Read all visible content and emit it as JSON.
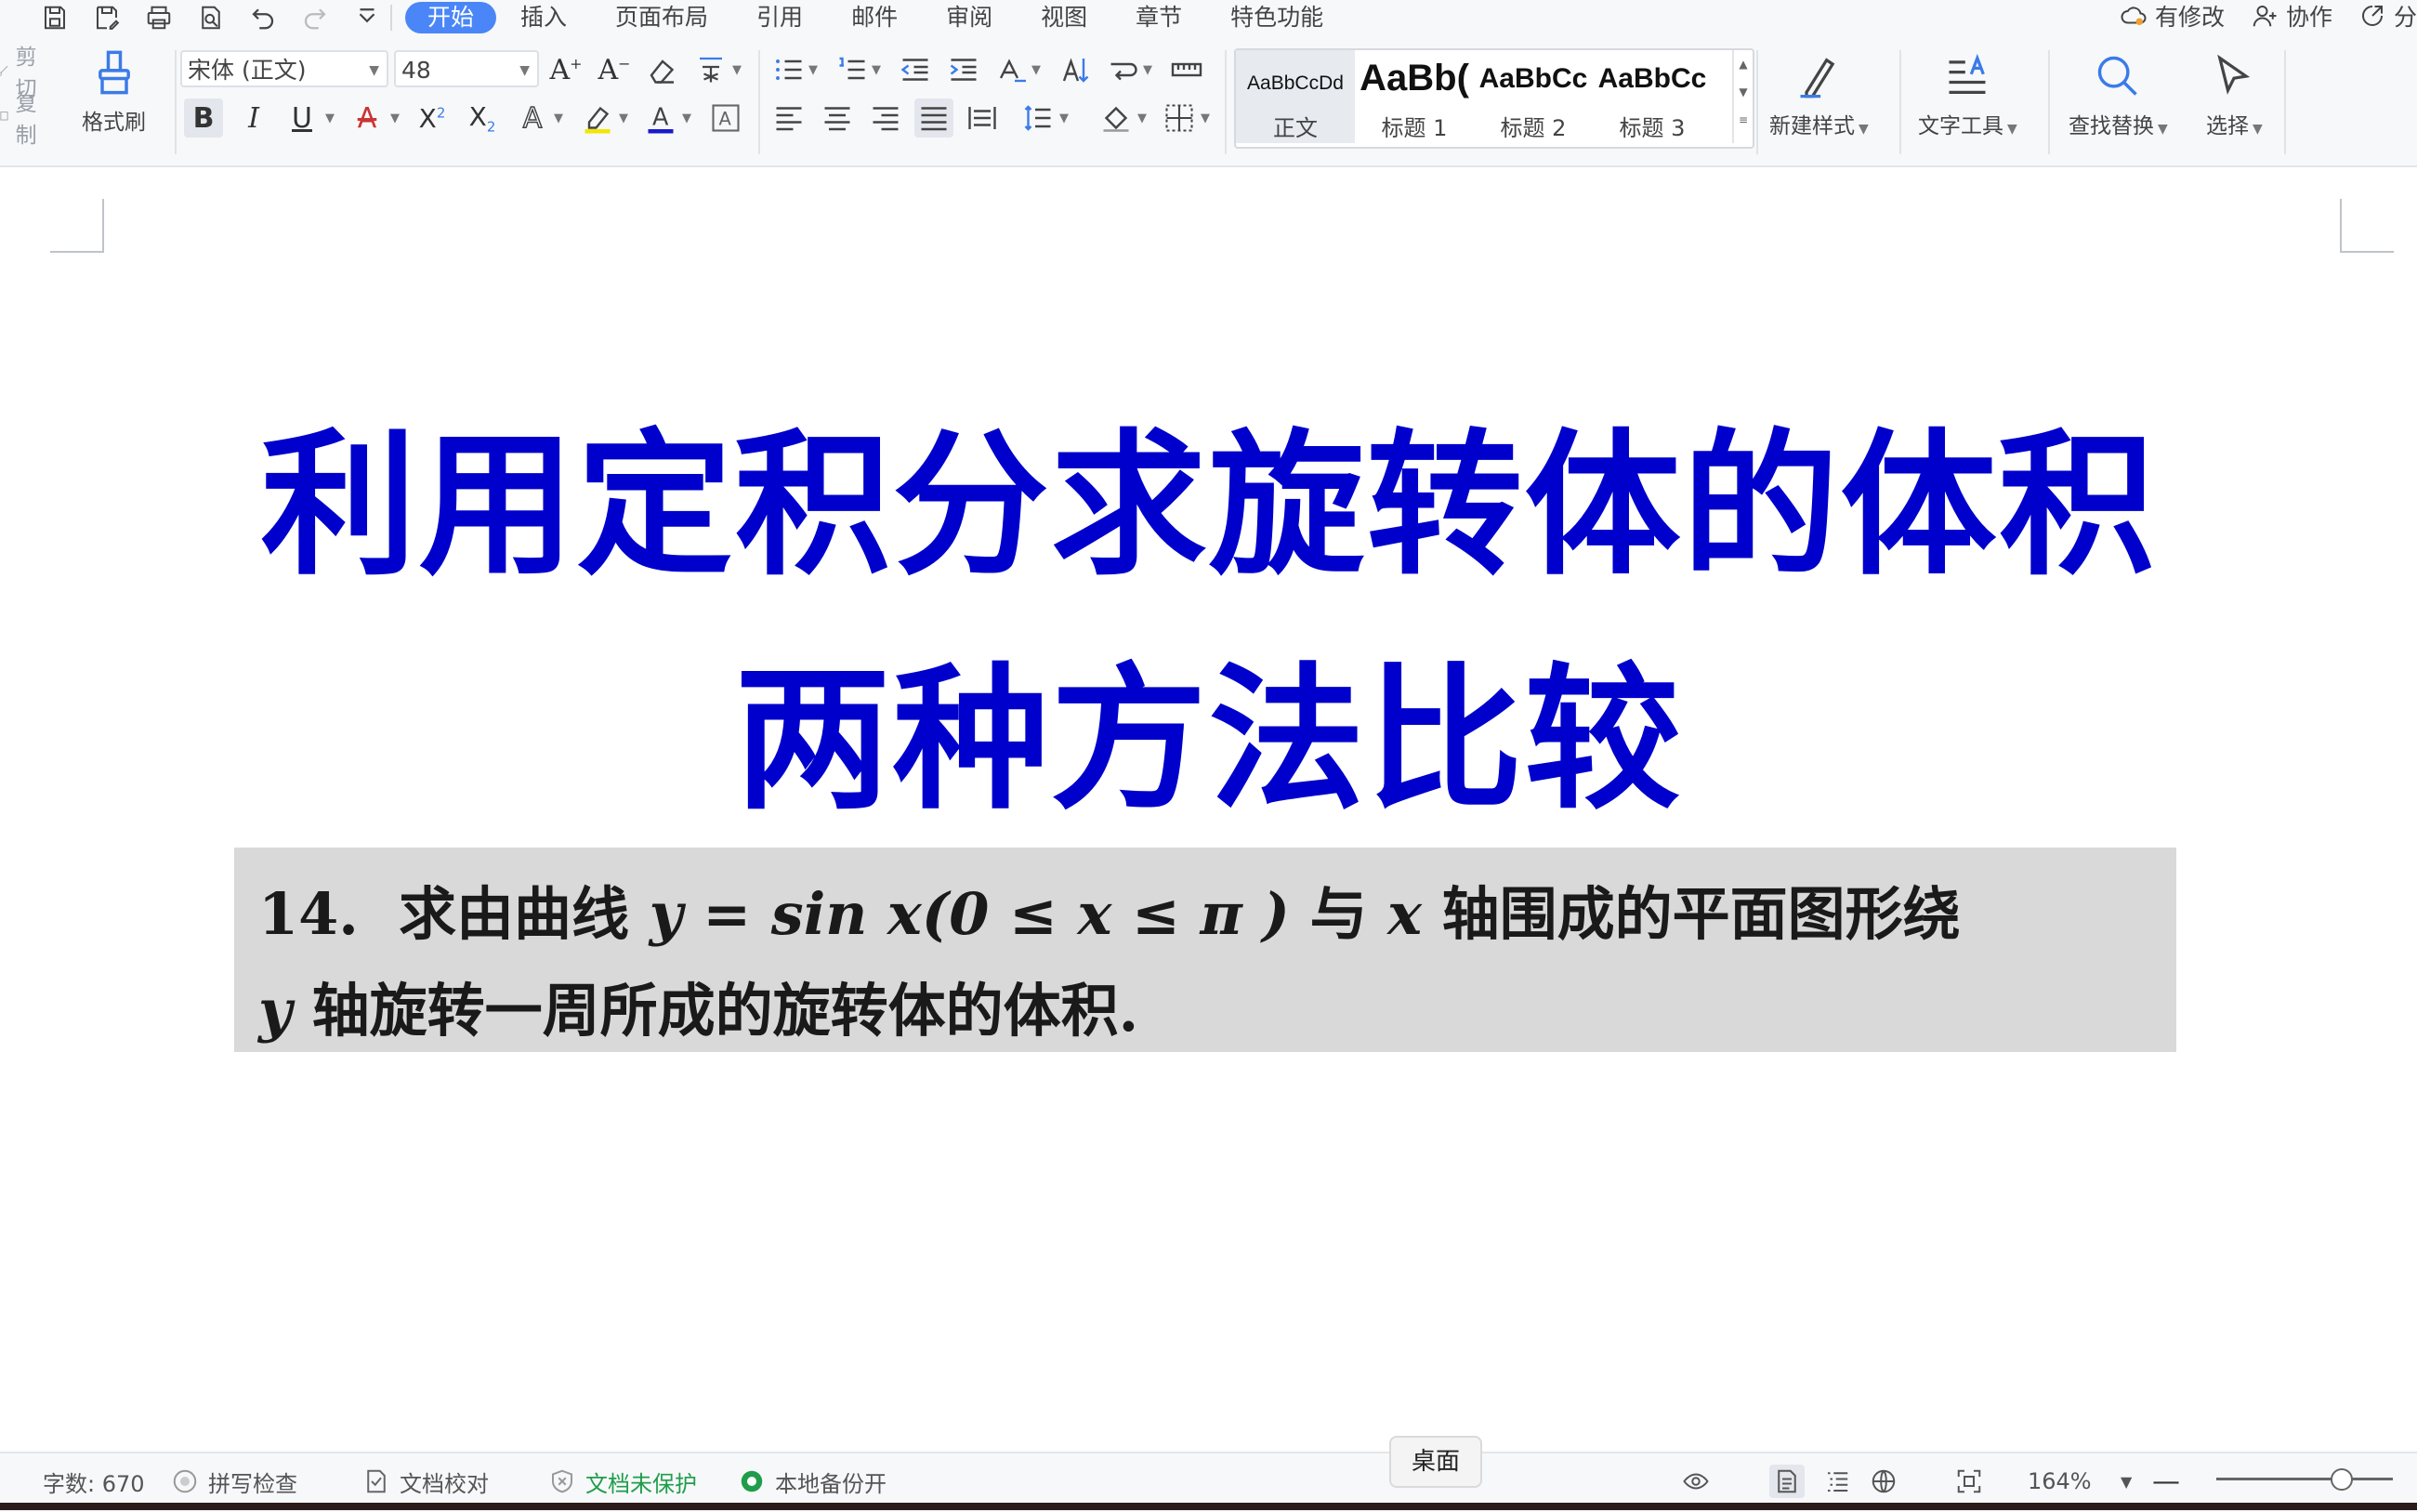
{
  "quick_access": [
    "save-icon",
    "save-as-icon",
    "print-icon",
    "print-preview-icon",
    "undo-icon",
    "redo-icon",
    "more-icon"
  ],
  "tabs": [
    {
      "label": "开始",
      "active": true
    },
    {
      "label": "插入"
    },
    {
      "label": "页面布局"
    },
    {
      "label": "引用"
    },
    {
      "label": "邮件"
    },
    {
      "label": "审阅"
    },
    {
      "label": "视图"
    },
    {
      "label": "章节"
    },
    {
      "label": "特色功能"
    }
  ],
  "top_right": {
    "changes": "有修改",
    "collab": "协作",
    "share": "分"
  },
  "ribbon": {
    "cut": "剪切",
    "copy": "复制",
    "format_painter": "格式刷",
    "font_name": "宋体 (正文)",
    "font_size": "48",
    "styles": [
      {
        "preview": "AaBbCcDd",
        "name": "正文",
        "selected": true
      },
      {
        "preview": "AaBb(",
        "name": "标题 1"
      },
      {
        "preview": "AaBbCc",
        "name": "标题 2"
      },
      {
        "preview": "AaBbCc",
        "name": "标题 3"
      }
    ],
    "new_style": "新建样式",
    "text_tools": "文字工具",
    "find_replace": "查找替换",
    "select": "选择"
  },
  "document": {
    "title_line1": "利用定积分求旋转体的体积",
    "title_line2": "两种方法比较",
    "title_color": "#0000cc",
    "problem_number": "14.",
    "problem_line1_a": "求由曲线",
    "problem_formula": "y = sin x(0 ≤ x ≤ π )",
    "problem_line1_b": "与",
    "problem_x": "x",
    "problem_line1_c": "轴围成的平面图形绕",
    "problem_y": "y",
    "problem_line2": "轴旋转一周所成的旋转体的体积."
  },
  "status": {
    "word_count": "字数: 670",
    "spell_check": "拼写检查",
    "doc_proof": "文档校对",
    "unprotected": "文档未保护",
    "local_backup": "本地备份开",
    "tooltip": "桌面",
    "zoom": "164%"
  },
  "colors": {
    "accent": "#4a86f7",
    "status_green": "#1f9d4a"
  }
}
